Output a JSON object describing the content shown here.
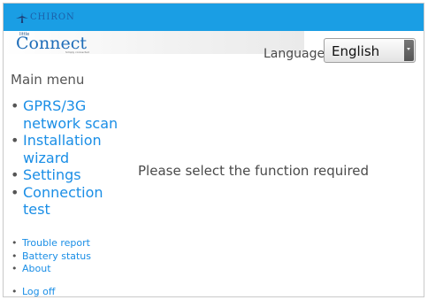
{
  "brand": {
    "name": "CHIRON"
  },
  "logo": {
    "small": "little",
    "main": "Connect",
    "tagline": "Simply connected"
  },
  "language": {
    "label": "Language:",
    "selected": "English"
  },
  "menu": {
    "title": "Main menu",
    "primary_items": [
      {
        "label": "GPRS/3G network scan"
      },
      {
        "label": "Installation wizard"
      },
      {
        "label": "Settings"
      },
      {
        "label": "Connection test"
      }
    ],
    "secondary_items": [
      {
        "label": "Trouble report"
      },
      {
        "label": "Battery status"
      },
      {
        "label": "About"
      }
    ],
    "logoff": "Log off"
  },
  "main": {
    "message": "Please select the function required"
  },
  "colors": {
    "topbar": "#1a9ee4",
    "link": "#1a8ee6",
    "logo": "#1d6cb8",
    "brand_mark": "#1c5fa8"
  },
  "icons": [
    "chiron-logo-icon",
    "dropdown-arrow-icon"
  ]
}
